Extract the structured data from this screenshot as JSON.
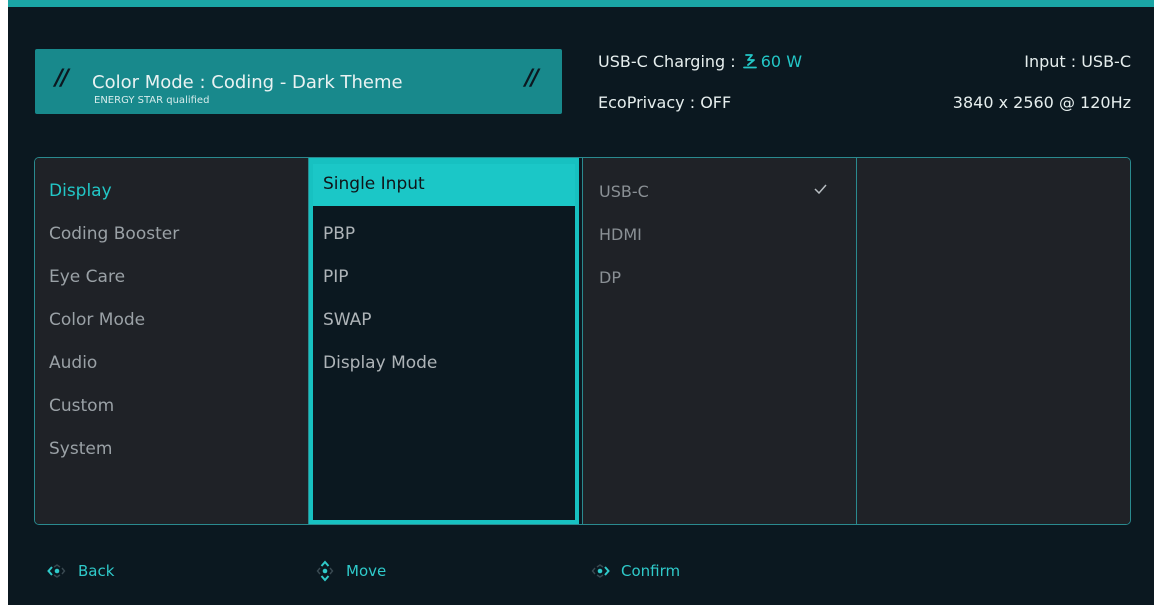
{
  "header": {
    "color_mode": "Color Mode : Coding - Dark Theme",
    "energy_star": "ENERGY STAR qualified",
    "charging_label": "USB-C Charging : ",
    "charging_value": "60 W",
    "ecoprivacy": "EcoPrivacy : OFF",
    "input": "Input : USB-C",
    "resolution": "3840 x 2560 @ 120Hz"
  },
  "main_menu": {
    "items": [
      {
        "label": "Display"
      },
      {
        "label": "Coding Booster"
      },
      {
        "label": "Eye Care"
      },
      {
        "label": "Color Mode"
      },
      {
        "label": "Audio"
      },
      {
        "label": "Custom"
      },
      {
        "label": "System"
      }
    ],
    "selected": "Display"
  },
  "sub_menu": {
    "items": [
      {
        "label": "Single Input"
      },
      {
        "label": "PBP"
      },
      {
        "label": "PIP"
      },
      {
        "label": "SWAP"
      },
      {
        "label": "Display Mode"
      }
    ],
    "selected": "Single Input"
  },
  "options": {
    "items": [
      {
        "label": "USB-C"
      },
      {
        "label": "HDMI"
      },
      {
        "label": "DP"
      }
    ],
    "checked": "USB-C"
  },
  "footer": {
    "back": "Back",
    "move": "Move",
    "confirm": "Confirm"
  },
  "colors": {
    "accent": "#1bc7c7",
    "banner": "#18898c",
    "background": "#0b1820",
    "panel": "#1f2227"
  },
  "icons": [
    "plug-icon",
    "checkmark-icon",
    "dpad-left-icon",
    "dpad-updown-icon",
    "dpad-right-icon"
  ]
}
